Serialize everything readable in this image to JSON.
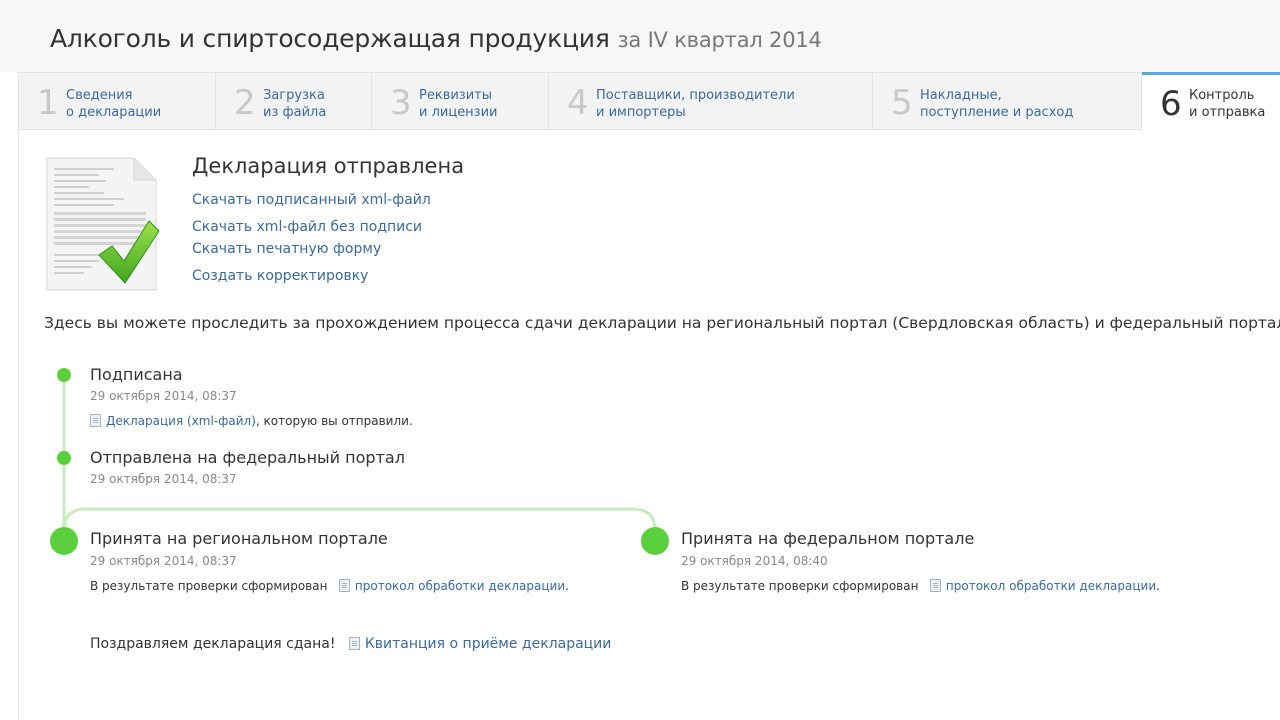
{
  "header": {
    "title": "Алкоголь и спиртосодержащая продукция",
    "subtitle": "за IV квартал 2014"
  },
  "tabs": [
    {
      "num": "1",
      "line1": "Сведения",
      "line2": "о декларации"
    },
    {
      "num": "2",
      "line1": "Загрузка",
      "line2": "из файла"
    },
    {
      "num": "3",
      "line1": "Реквизиты",
      "line2": "и лицензии"
    },
    {
      "num": "4",
      "line1": "Поставщики, производители",
      "line2": "и импортеры"
    },
    {
      "num": "5",
      "line1": "Накладные,",
      "line2": "поступление и расход"
    },
    {
      "num": "6",
      "line1": "Контроль",
      "line2": "и отправка"
    }
  ],
  "status": {
    "title": "Декларация отправлена",
    "links": [
      "Скачать подписанный xml-файл",
      "Скачать xml-файл без подписи",
      "Скачать печатную форму",
      "Создать корректировку"
    ]
  },
  "intro": "Здесь вы можете проследить за прохождением процесса сдачи декларации на региональный портал (Свердловская область) и федеральный портал:",
  "timeline": {
    "signed": {
      "title": "Подписана",
      "date": "29 октября 2014, 08:37",
      "link": "Декларация (xml-файл)",
      "text": ", которую вы отправили."
    },
    "sent_federal": {
      "title": "Отправлена на федеральный портал",
      "date": "29 октября 2014, 08:37"
    },
    "accepted_regional": {
      "title": "Принята на региональном портале",
      "date": "29 октября 2014, 08:37",
      "text": "В результате проверки сформирован",
      "link": "протокол обработки декларации",
      "suffix": "."
    },
    "accepted_federal": {
      "title": "Принята на федеральном портале",
      "date": "29 октября 2014, 08:40",
      "text": "В результате проверки сформирован",
      "link": "протокол обработки декларации",
      "suffix": "."
    }
  },
  "final": {
    "text": "Поздравляем декларация сдана!",
    "link": "Квитанция о приёме декларации"
  },
  "colors": {
    "accent_green": "#5ad13c",
    "line_green": "#c9ebbf",
    "link_blue": "#3a6a9c",
    "active_tab_border": "#5aa9dc"
  }
}
